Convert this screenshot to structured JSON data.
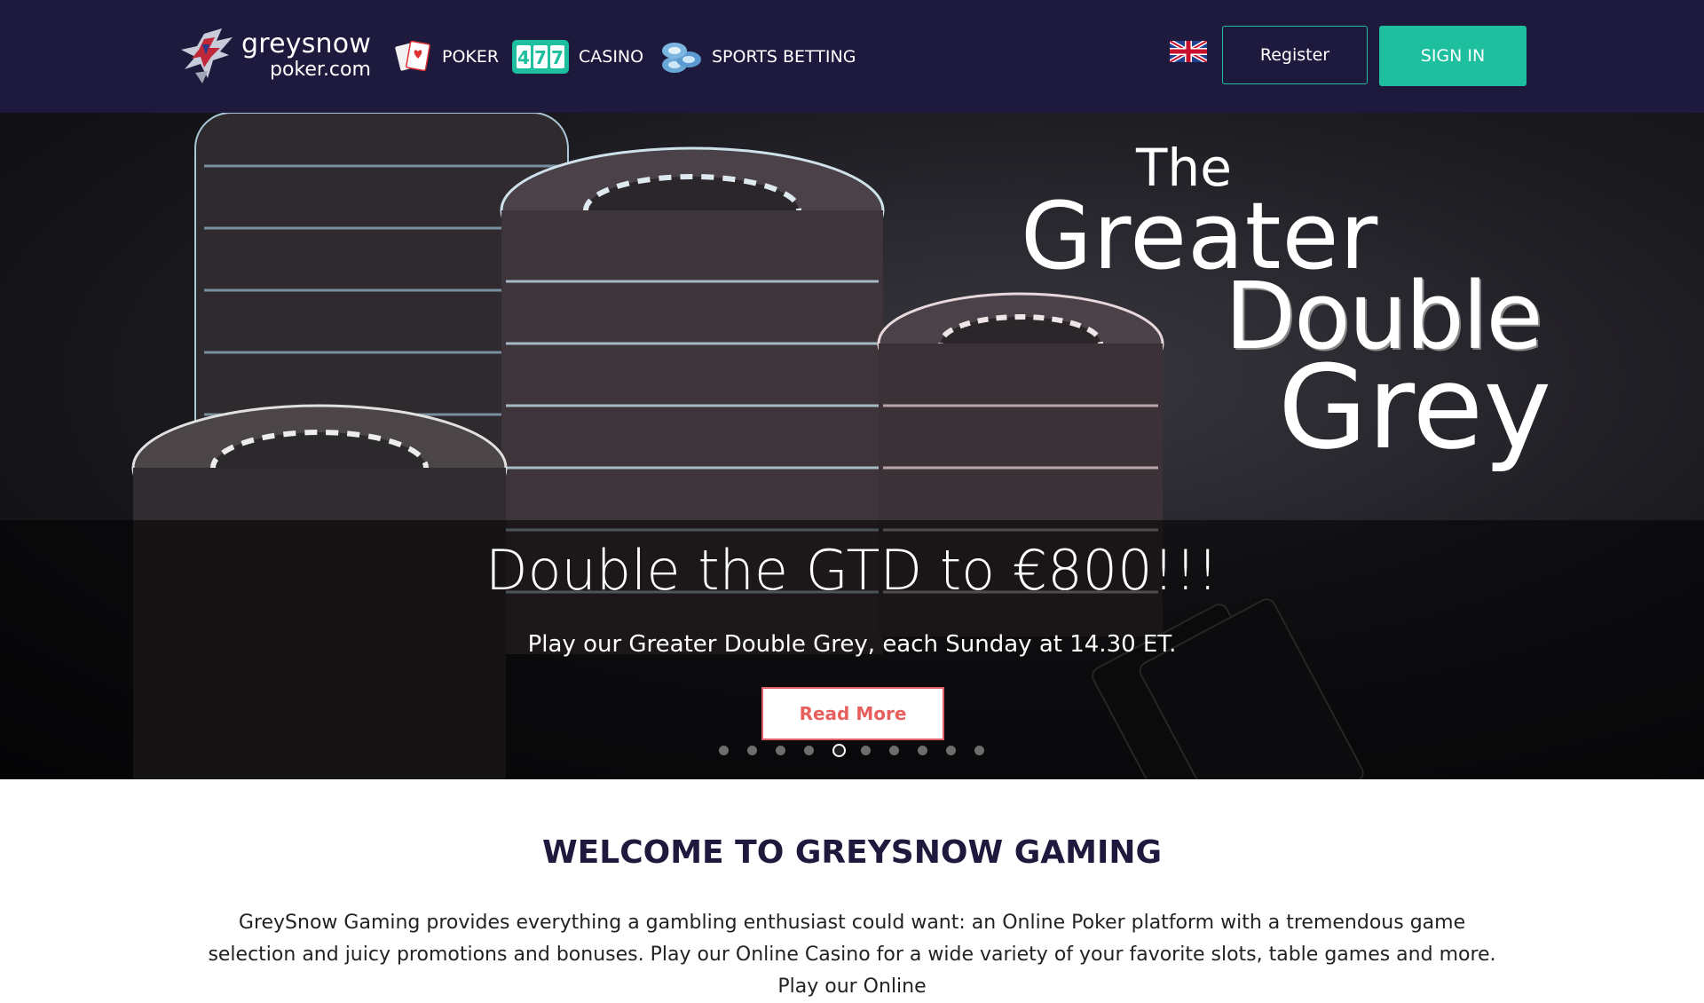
{
  "header": {
    "logo": {
      "line1": "greysnow",
      "line2": "poker.com"
    },
    "nav": [
      {
        "label": "POKER",
        "icon": "playing-cards-icon"
      },
      {
        "label": "CASINO",
        "icon": "slot-777-icon"
      },
      {
        "label": "SPORTS BETTING",
        "icon": "chip-stack-icon"
      }
    ],
    "language_flag": "uk-flag-icon",
    "register_label": "Register",
    "signin_label": "SIGN IN"
  },
  "colors": {
    "header_bg": "#1d1a3d",
    "accent_teal": "#1dbf9e",
    "read_more_red": "#e8605e"
  },
  "hero": {
    "art_title": {
      "line1": "The",
      "line2": "Greater",
      "line3": "Double",
      "line4": "Grey"
    },
    "headline": "Double the GTD to €800!!!",
    "subtitle": "Play our Greater Double Grey, each Sunday at 14.30 ET.",
    "button_label": "Read More",
    "slides_total": 10,
    "active_slide": 5
  },
  "welcome": {
    "title": "WELCOME TO GREYSNOW GAMING",
    "text": "GreySnow Gaming provides everything a gambling enthusiast could want: an Online Poker platform with a tremendous game selection and juicy promotions and bonuses. Play our Online Casino for a wide variety of your favorite slots, table games and more. Play our Online"
  }
}
